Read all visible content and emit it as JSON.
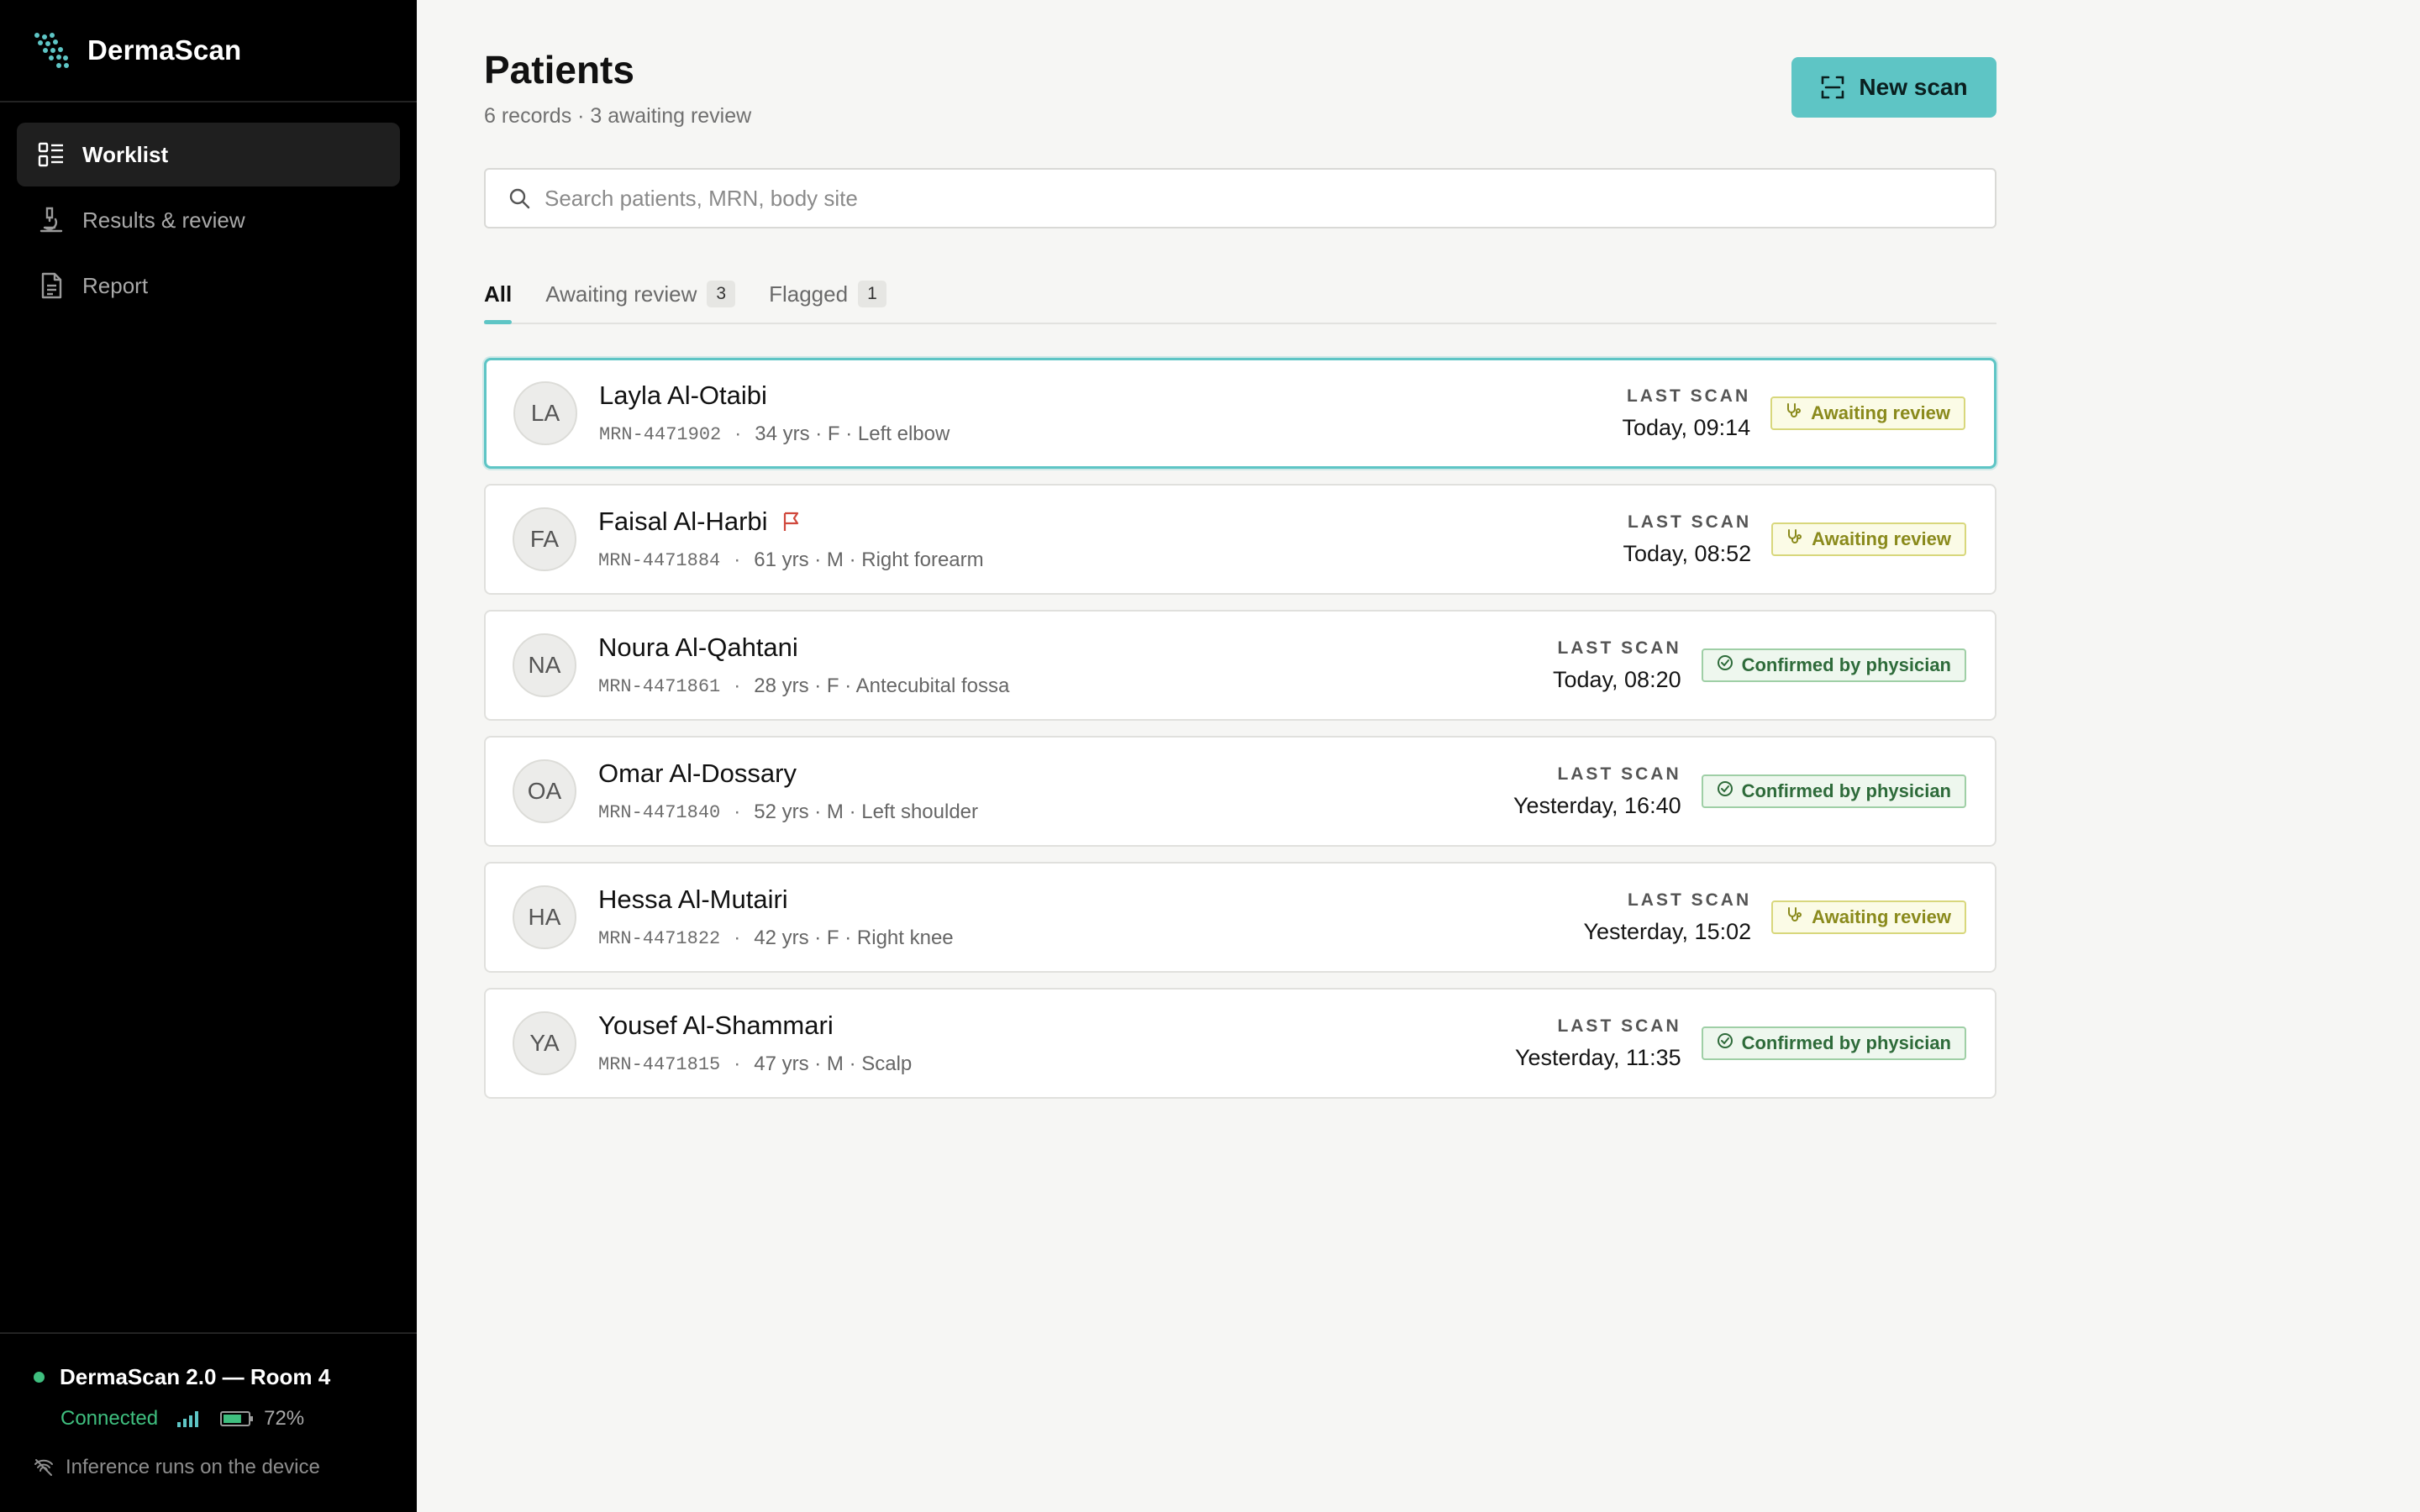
{
  "app": {
    "name": "DermaScan",
    "brand_color": "#5ec5c5"
  },
  "sidebar": {
    "items": [
      {
        "label": "Worklist",
        "icon": "list-icon",
        "active": true
      },
      {
        "label": "Results & review",
        "icon": "microscope-icon",
        "active": false
      },
      {
        "label": "Report",
        "icon": "document-icon",
        "active": false
      }
    ],
    "device": {
      "name": "DermaScan 2.0 — Room 4",
      "status": "Connected",
      "battery": "72%",
      "battery_level": 0.72,
      "note": "Inference runs on the device"
    }
  },
  "header": {
    "title": "Patients",
    "subtitle": "6 records · 3 awaiting review",
    "new_scan_label": "New scan"
  },
  "search": {
    "placeholder": "Search patients, MRN, body site"
  },
  "tabs": [
    {
      "label": "All",
      "count": ""
    },
    {
      "label": "Awaiting review",
      "count": "3"
    },
    {
      "label": "Flagged",
      "count": "1"
    }
  ],
  "patients": [
    {
      "initials": "LA",
      "name": "Layla Al-Otaibi",
      "flagged": false,
      "mrn": "MRN-4471902",
      "details": "34 yrs · F · Left elbow",
      "last_scan_label": "LAST SCAN",
      "last_scan": "Today, 09:14",
      "status": "Awaiting review",
      "status_type": "awaiting",
      "selected": true
    },
    {
      "initials": "FA",
      "name": "Faisal Al-Harbi",
      "flagged": true,
      "mrn": "MRN-4471884",
      "details": "61 yrs · M · Right forearm",
      "last_scan_label": "LAST SCAN",
      "last_scan": "Today, 08:52",
      "status": "Awaiting review",
      "status_type": "awaiting",
      "selected": false
    },
    {
      "initials": "NA",
      "name": "Noura Al-Qahtani",
      "flagged": false,
      "mrn": "MRN-4471861",
      "details": "28 yrs · F · Antecubital fossa",
      "last_scan_label": "LAST SCAN",
      "last_scan": "Today, 08:20",
      "status": "Confirmed by physician",
      "status_type": "confirmed",
      "selected": false
    },
    {
      "initials": "OA",
      "name": "Omar Al-Dossary",
      "flagged": false,
      "mrn": "MRN-4471840",
      "details": "52 yrs · M · Left shoulder",
      "last_scan_label": "LAST SCAN",
      "last_scan": "Yesterday, 16:40",
      "status": "Confirmed by physician",
      "status_type": "confirmed",
      "selected": false
    },
    {
      "initials": "HA",
      "name": "Hessa Al-Mutairi",
      "flagged": false,
      "mrn": "MRN-4471822",
      "details": "42 yrs · F · Right knee",
      "last_scan_label": "LAST SCAN",
      "last_scan": "Yesterday, 15:02",
      "status": "Awaiting review",
      "status_type": "awaiting",
      "selected": false
    },
    {
      "initials": "YA",
      "name": "Yousef Al-Shammari",
      "flagged": false,
      "mrn": "MRN-4471815",
      "details": "47 yrs · M · Scalp",
      "last_scan_label": "LAST SCAN",
      "last_scan": "Yesterday, 11:35",
      "status": "Confirmed by physician",
      "status_type": "confirmed",
      "selected": false
    }
  ]
}
